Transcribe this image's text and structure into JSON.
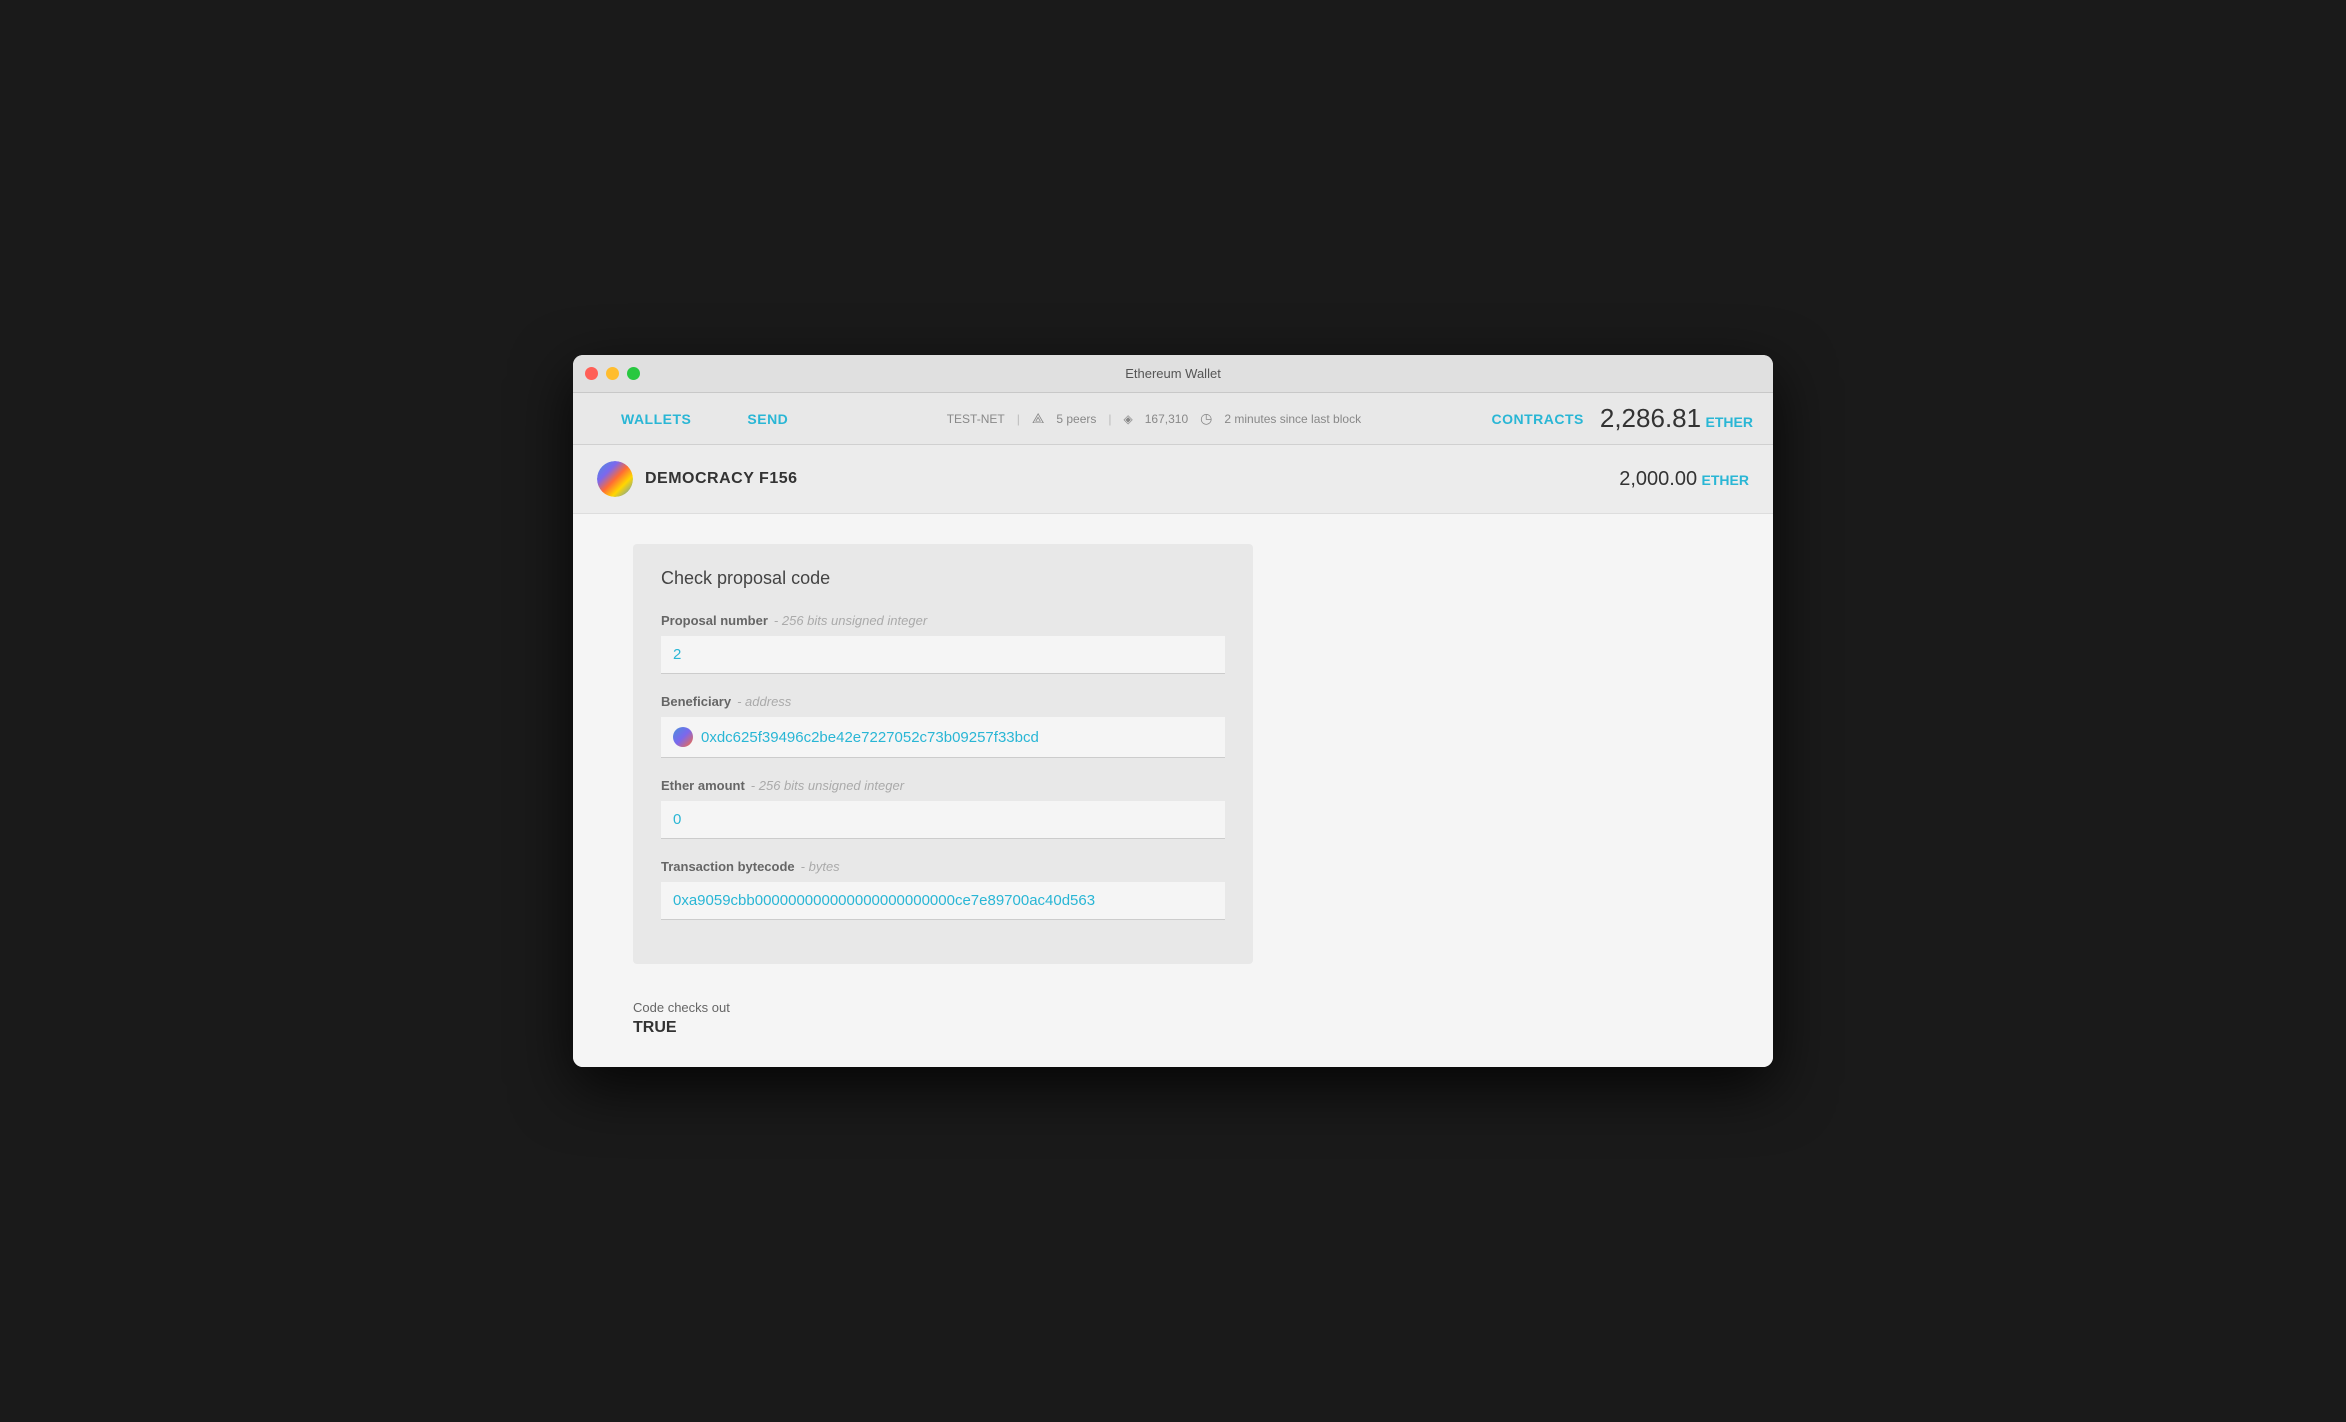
{
  "window": {
    "title": "Ethereum Wallet"
  },
  "navbar": {
    "wallets_label": "WALLETS",
    "send_label": "SEND",
    "network_label": "TEST-NET",
    "peers_count": "5 peers",
    "blocks_count": "167,310",
    "time_since_block": "2 minutes since last block",
    "contracts_label": "CONTRACTS",
    "balance_amount": "2,286.81",
    "balance_unit": "ETHER"
  },
  "account": {
    "name": "DEMOCRACY F156",
    "balance_amount": "2,000.00",
    "balance_unit": "ETHER"
  },
  "proposal_card": {
    "title": "Check proposal code",
    "proposal_number_label": "Proposal number",
    "proposal_number_type": "256 bits unsigned integer",
    "proposal_number_value": "2",
    "beneficiary_label": "Beneficiary",
    "beneficiary_type": "address",
    "beneficiary_value": "0xdc625f39496c2be42e7227052c73b09257f33bcd",
    "ether_amount_label": "Ether amount",
    "ether_amount_type": "256 bits unsigned integer",
    "ether_amount_value": "0",
    "bytecode_label": "Transaction bytecode",
    "bytecode_type": "bytes",
    "bytecode_value": "0xa9059cbb000000000000000000000000ce7e89700ac40d563",
    "result_label": "Code checks out",
    "result_value": "TRUE"
  }
}
